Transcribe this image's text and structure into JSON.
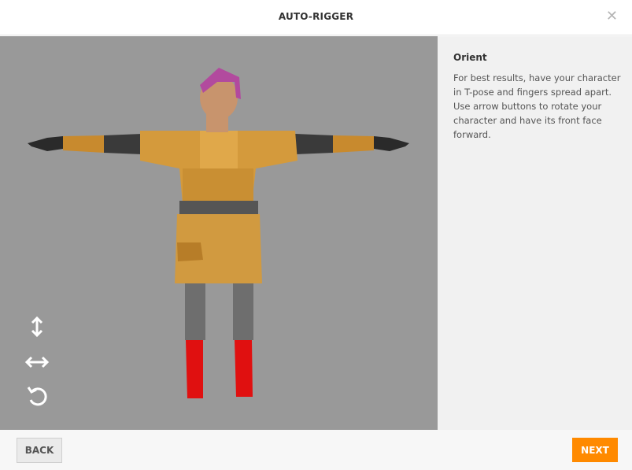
{
  "header": {
    "title": "AUTO-RIGGER",
    "close_icon": "close-icon"
  },
  "panel": {
    "heading": "Orient",
    "description": "For best results, have your character in T-pose and fingers spread apart. Use arrow buttons to rotate your character and have its front face forward."
  },
  "controls": [
    {
      "name": "vertical-arrow-icon"
    },
    {
      "name": "horizontal-arrow-icon"
    },
    {
      "name": "rotate-icon"
    }
  ],
  "footer": {
    "back_label": "BACK",
    "next_label": "NEXT"
  },
  "colors": {
    "accent": "#ff8a00",
    "viewport_bg": "#999999",
    "panel_bg": "#f1f1f1"
  }
}
